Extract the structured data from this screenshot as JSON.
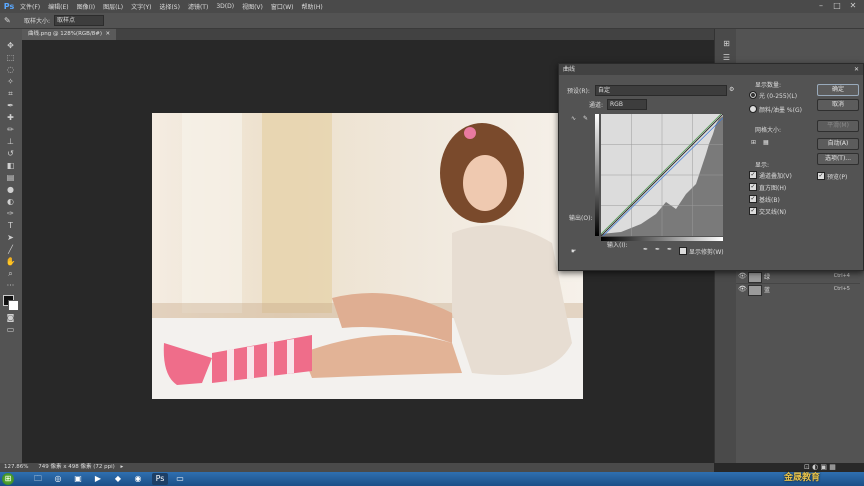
{
  "app": {
    "logo": "Ps"
  },
  "menu": [
    "文件(F)",
    "编辑(E)",
    "图像(I)",
    "图层(L)",
    "文字(Y)",
    "选择(S)",
    "滤镜(T)",
    "3D(D)",
    "视图(V)",
    "窗口(W)",
    "帮助(H)"
  ],
  "options_bar": {
    "sample_size_label": "取样大小:",
    "sample_size_value": "取样点"
  },
  "document_tab": {
    "title": "曲线.png @ 128%(RGB/8#)"
  },
  "status_bar": {
    "zoom": "127.86%",
    "doc_info": "749 像素 x 498 像素 (72 ppi)"
  },
  "curves_dialog": {
    "title": "曲线",
    "preset_label": "预设(R):",
    "preset_value": "自定",
    "channel_label": "通道:",
    "channel_value": "RGB",
    "output_label": "输出(O):",
    "input_label": "输入(I):",
    "show_clipping": "显示修剪(W)",
    "display_amount_label": "显示数量:",
    "light_option": "光 (0-255)(L)",
    "pigment_option": "颜料/油墨 %(G)",
    "grid_size_label": "网格大小:",
    "show_label": "显示:",
    "show_options": [
      "通道叠加(V)",
      "直方图(H)",
      "基线(B)",
      "交叉线(N)"
    ],
    "buttons": {
      "ok": "确定",
      "cancel": "取消",
      "smooth": "平滑(M)",
      "auto": "自动(A)",
      "options": "选项(T)..."
    },
    "preview_label": "预览(P)"
  },
  "layers": [
    {
      "name": "绿",
      "shortcut": "Ctrl+4"
    },
    {
      "name": "蓝",
      "shortcut": "Ctrl+5"
    }
  ],
  "watermark": "金晟教育",
  "accent_colors": {
    "menubar": "#4a4a4a",
    "panel": "#535353",
    "canvas": "#282828",
    "taskbar": "#2f6fb0"
  }
}
